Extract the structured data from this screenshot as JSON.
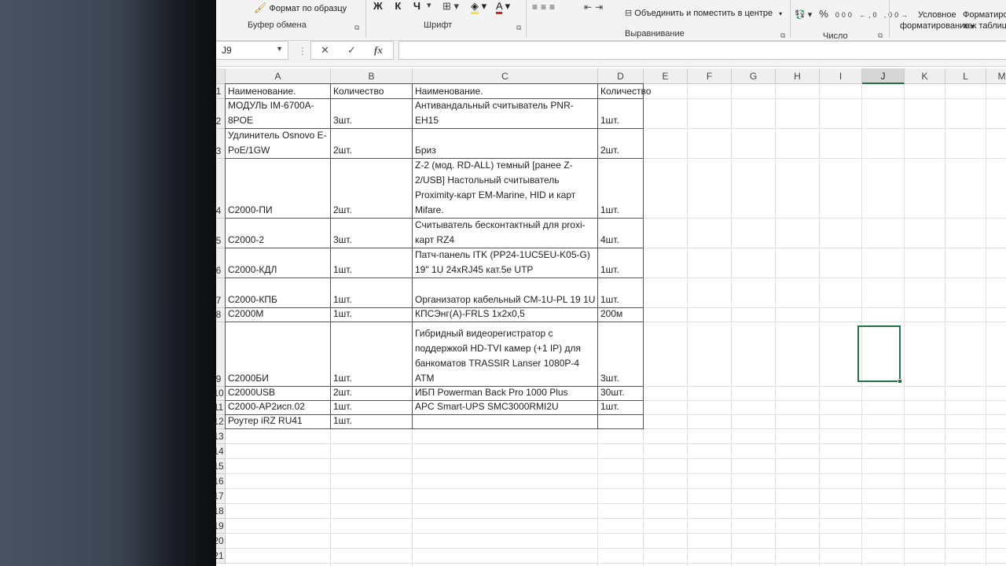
{
  "ribbon": {
    "format_painter": "Формат по образцу",
    "clipboard_label": "Буфер обмена",
    "font_buttons": "Ж К Ч",
    "font_label": "Шрифт",
    "merge_center": "Объединить и поместить в центре",
    "alignment_label": "Выравнивание",
    "percent_style": "%",
    "thousands": "000",
    "number_label": "Число",
    "conditional_formatting": [
      "Условное",
      "форматирование"
    ],
    "format_as_table": [
      "Форматиро",
      "как таблиц"
    ]
  },
  "formula_bar": {
    "name_box": "J9",
    "cancel_icon": "✕",
    "enter_icon": "✓",
    "fx": "fx",
    "formula": ""
  },
  "columns": [
    "A",
    "B",
    "C",
    "D",
    "E",
    "F",
    "G",
    "H",
    "I",
    "J",
    "K",
    "L",
    "M"
  ],
  "selected_column": "J",
  "rows": [
    "1",
    "2",
    "3",
    "4",
    "5",
    "6",
    "7",
    "8",
    "9",
    "10",
    "11",
    "12",
    "13",
    "14",
    "15",
    "16",
    "17",
    "18",
    "19",
    "20",
    "21"
  ],
  "table": [
    {
      "row": "1",
      "a": "Наименование.",
      "b": "Количество",
      "c": "Наименование.",
      "d": "Количество"
    },
    {
      "row": "2",
      "a": "МОДУЛЬ IM-6700A-8POE",
      "b": "3шт.",
      "c": "Антивандальный считыватель PNR-EH15",
      "d": "1шт."
    },
    {
      "row": "3",
      "a": "Удлинитель Osnovo E-PoE/1GW",
      "b": "2шт.",
      "c": "Бриз",
      "d": "2шт."
    },
    {
      "row": "4",
      "a": "С2000-ПИ",
      "b": "2шт.",
      "c": "Z-2 (мод. RD-ALL) темный [ранее Z-2/USB] Настольный считыватель Proximity-карт EM-Marine, HID и карт Mifare.",
      "d": "1шт."
    },
    {
      "row": "5",
      "a": "С2000-2",
      "b": "3шт.",
      "c": "Считыватель бесконтактный для proxi-карт RZ4",
      "d": "4шт."
    },
    {
      "row": "6",
      "a": "С2000-КДЛ",
      "b": "1шт.",
      "c": "Патч-панель ITK (PP24-1UC5EU-K05-G) 19\" 1U 24xRJ45 кат.5е UTP",
      "d": "1шт."
    },
    {
      "row": "7",
      "a": "С2000-КПБ",
      "b": "1шт.",
      "c": "Организатор кабельный CM-1U-PL 19 1U",
      "d": "1шт."
    },
    {
      "row": "8",
      "a": "С2000М",
      "b": "1шт.",
      "c": "КПСЭнг(А)-FRLS 1x2x0,5",
      "d": "200м"
    },
    {
      "row": "9",
      "a": "С2000БИ",
      "b": "1шт.",
      "c": "Гибридный видеорегистратор с поддержкой HD-TVI камер (+1 IP) для банкоматов TRASSIR Lanser 1080P-4 ATM",
      "d": "3шт."
    },
    {
      "row": "10",
      "a": "С2000USB",
      "b": "2шт.",
      "c": "ИБП Powerman Back Pro 1000 Plus",
      "d": "30шт."
    },
    {
      "row": "11",
      "a": "С2000-АР2исп.02",
      "b": "1шт.",
      "c": "APC Smart-UPS SMC3000RMI2U",
      "d": "1шт."
    },
    {
      "row": "12",
      "a": "Роутер iRZ RU41",
      "b": "1шт.",
      "c": "",
      "d": ""
    }
  ]
}
